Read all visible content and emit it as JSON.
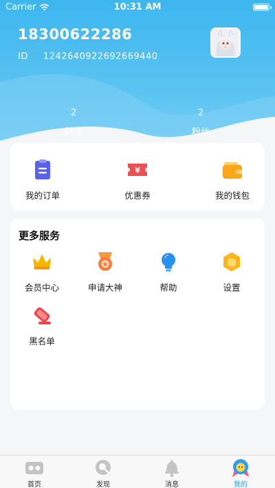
{
  "status_bar": {
    "carrier": "Carrier",
    "time": "10:31 AM"
  },
  "profile": {
    "phone": "18300622286",
    "id_label": "ID",
    "id_value": "1242640922692669440"
  },
  "stats": [
    {
      "value": "2",
      "label": "关注"
    },
    {
      "value": "2",
      "label": "粉丝"
    }
  ],
  "quick_actions": [
    {
      "label": "我的订单",
      "icon": "clipboard-icon"
    },
    {
      "label": "优惠券",
      "icon": "coupon-icon"
    },
    {
      "label": "我的钱包",
      "icon": "wallet-icon"
    }
  ],
  "services": {
    "title": "更多服务",
    "items": [
      {
        "label": "会员中心",
        "icon": "crown-icon"
      },
      {
        "label": "申请大神",
        "icon": "medal-icon"
      },
      {
        "label": "帮助",
        "icon": "lightbulb-icon"
      },
      {
        "label": "设置",
        "icon": "hexagon-settings-icon"
      },
      {
        "label": "黑名单",
        "icon": "blacklist-icon"
      }
    ]
  },
  "tabbar": [
    {
      "label": "首页",
      "icon": "home-vr-icon",
      "active": false
    },
    {
      "label": "发现",
      "icon": "search-icon",
      "active": false
    },
    {
      "label": "消息",
      "icon": "bell-icon",
      "active": false
    },
    {
      "label": "我的",
      "icon": "profile-character-icon",
      "active": true
    }
  ],
  "colors": {
    "header_blue": "#3db6ee",
    "active_tab": "#2a9df4",
    "background": "#f5f6f8"
  }
}
